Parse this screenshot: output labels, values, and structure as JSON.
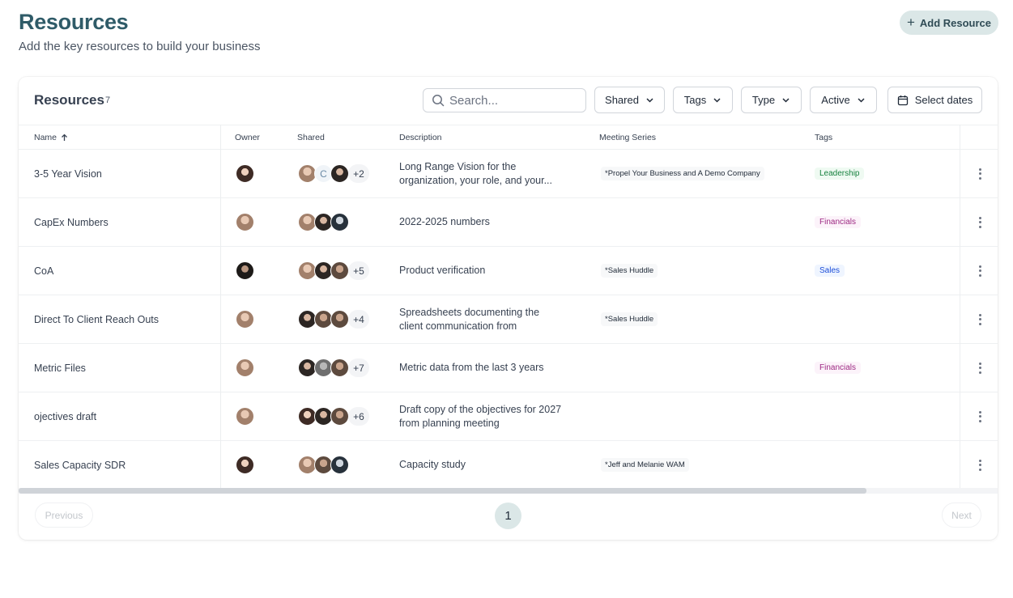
{
  "header": {
    "title": "Resources",
    "subtitle": "Add the key resources to build your business",
    "add_button": "Add Resource"
  },
  "toolbar": {
    "title": "Resources",
    "count": "7",
    "search_placeholder": "Search...",
    "filters": {
      "shared": "Shared",
      "tags": "Tags",
      "type": "Type",
      "status": "Active",
      "dates": "Select dates"
    }
  },
  "columns": {
    "name": "Name",
    "owner": "Owner",
    "shared": "Shared",
    "description": "Description",
    "meeting_series": "Meeting Series",
    "tags": "Tags"
  },
  "rows": [
    {
      "name": "3-5 Year Vision",
      "shared_more": "+2",
      "shared_letter": "C",
      "description": "Long Range Vision for the organization, your role, and your...",
      "series": "*Propel Your Business and A Demo Company",
      "tag": "Leadership",
      "tag_kind": "leadership"
    },
    {
      "name": "CapEx Numbers",
      "shared_more": "",
      "shared_letter": "",
      "description": "2022-2025 numbers",
      "series": "",
      "tag": "Financials",
      "tag_kind": "financials"
    },
    {
      "name": "CoA",
      "shared_more": "+5",
      "shared_letter": "",
      "description": "Product verification",
      "series": "*Sales Huddle",
      "tag": "Sales",
      "tag_kind": "sales"
    },
    {
      "name": "Direct To Client Reach Outs",
      "shared_more": "+4",
      "shared_letter": "",
      "description": "Spreadsheets documenting the client communication from customer...",
      "series": "*Sales Huddle",
      "tag": "",
      "tag_kind": ""
    },
    {
      "name": "Metric Files",
      "shared_more": "+7",
      "shared_letter": "",
      "description": "Metric data from the last 3 years",
      "series": "",
      "tag": "Financials",
      "tag_kind": "financials"
    },
    {
      "name": "ojectives draft",
      "shared_more": "+6",
      "shared_letter": "",
      "description": "Draft copy of the objectives for 2027 from planning meeting",
      "series": "",
      "tag": "",
      "tag_kind": ""
    },
    {
      "name": "Sales Capacity SDR",
      "shared_more": "",
      "shared_letter": "",
      "description": "Capacity study",
      "series": "*Jeff and Melanie WAM",
      "tag": "",
      "tag_kind": ""
    }
  ],
  "pagination": {
    "previous": "Previous",
    "page": "1",
    "next": "Next"
  },
  "colors": {
    "title": "#2f5b68",
    "accent_bg": "#dbe7e7"
  }
}
